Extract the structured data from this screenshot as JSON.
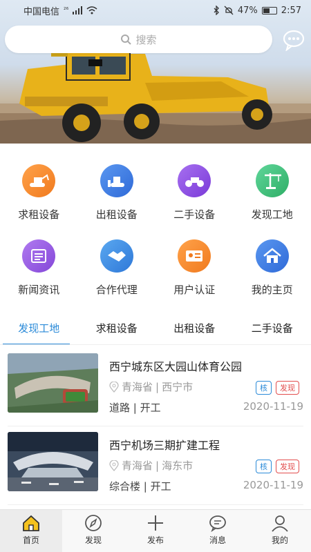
{
  "status_bar": {
    "carrier": "中国电信",
    "network": "²⁶",
    "battery": "47%",
    "time": "2:57",
    "battery_level": 0.47
  },
  "search": {
    "placeholder": "搜索"
  },
  "categories": [
    {
      "label": "求租设备",
      "icon": "excavator-icon",
      "color": "#f58a2c"
    },
    {
      "label": "出租设备",
      "icon": "bulldozer-icon",
      "color": "#3f7fe0"
    },
    {
      "label": "二手设备",
      "icon": "roller-icon",
      "color": "#8b4de0"
    },
    {
      "label": "发现工地",
      "icon": "crane-icon",
      "color": "#3fbf7b"
    },
    {
      "label": "新闻资讯",
      "icon": "newspaper-icon",
      "color": "#9a57e0"
    },
    {
      "label": "合作代理",
      "icon": "handshake-icon",
      "color": "#3f8fe0"
    },
    {
      "label": "用户认证",
      "icon": "id-card-icon",
      "color": "#f58a2c"
    },
    {
      "label": "我的主页",
      "icon": "house-icon",
      "color": "#3f7fe0"
    }
  ],
  "tabs": [
    "发现工地",
    "求租设备",
    "出租设备",
    "二手设备"
  ],
  "projects": [
    {
      "title": "西宁城东区大园山体育公园",
      "province": "青海省",
      "city": "西宁市",
      "category": "道路",
      "stage": "开工",
      "date": "2020-11-19",
      "tag1": "核",
      "tag2": "发现"
    },
    {
      "title": "西宁机场三期扩建工程",
      "province": "青海省",
      "city": "海东市",
      "category": "综合楼",
      "stage": "开工",
      "date": "2020-11-19",
      "tag1": "核",
      "tag2": "发现"
    }
  ],
  "bottom_nav": [
    {
      "label": "首页",
      "icon": "home-icon"
    },
    {
      "label": "发现",
      "icon": "compass-icon"
    },
    {
      "label": "发布",
      "icon": "plus-icon"
    },
    {
      "label": "消息",
      "icon": "message-icon"
    },
    {
      "label": "我的",
      "icon": "user-icon"
    }
  ],
  "colors": {
    "accent": "#2a8ad8",
    "tag_red": "#e24c4c"
  }
}
